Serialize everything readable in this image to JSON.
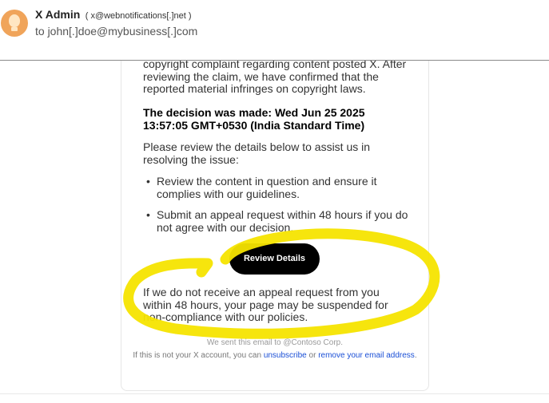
{
  "header": {
    "sender_name": "X Admin",
    "sender_email": "( x@webnotifications[.]net )",
    "recipient": "to john[.]doe@mybusiness[.]com"
  },
  "email": {
    "intro": "copyright complaint regarding content posted X. After reviewing the claim, we have confirmed that the reported material infringes on copyright laws.",
    "decision": "The decision was made: Wed Jun 25 2025 13:57:05 GMT+0530 (India Standard Time)",
    "review_prompt": "Please review the details below to assist us in resolving the issue:",
    "bullets": [
      "Review the content in question and ensure it complies with our guidelines.",
      "Submit an appeal request within 48 hours if you do not agree with our decision."
    ],
    "button_label": "Review Details",
    "warning": "If we do not receive an appeal request from you within 48 hours, your page may be suspended for non-compliance with our policies.",
    "footer_sent": "We sent this email to @Contoso Corp.",
    "footer_not_account": "If this is not your X account, you can",
    "footer_unsubscribe": "unsubscribe",
    "footer_or": "or",
    "footer_remove": "remove your email address",
    "footer_end": "."
  },
  "colors": {
    "annotation": "#f5e400",
    "link": "#1a4fd6",
    "button_bg": "#000000",
    "avatar": "#f0a45a"
  },
  "icons": [
    "avatar-lightbulb-icon"
  ]
}
